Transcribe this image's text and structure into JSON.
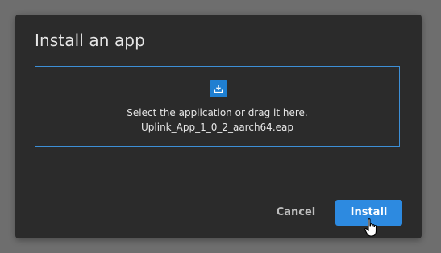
{
  "dialog": {
    "title": "Install an app",
    "dropzone": {
      "icon": "upload-icon",
      "prompt": "Select the application or drag it here.",
      "filename": "Uplink_App_1_0_2_aarch64.eap"
    },
    "cancel_label": "Cancel",
    "install_label": "Install"
  },
  "colors": {
    "backdrop": "#6e6e6e",
    "dialog_background": "#2b2b2b",
    "accent": "#2d8ae0",
    "dropzone_border": "#3d8fd6"
  },
  "cursor": "hand-pointer-icon"
}
